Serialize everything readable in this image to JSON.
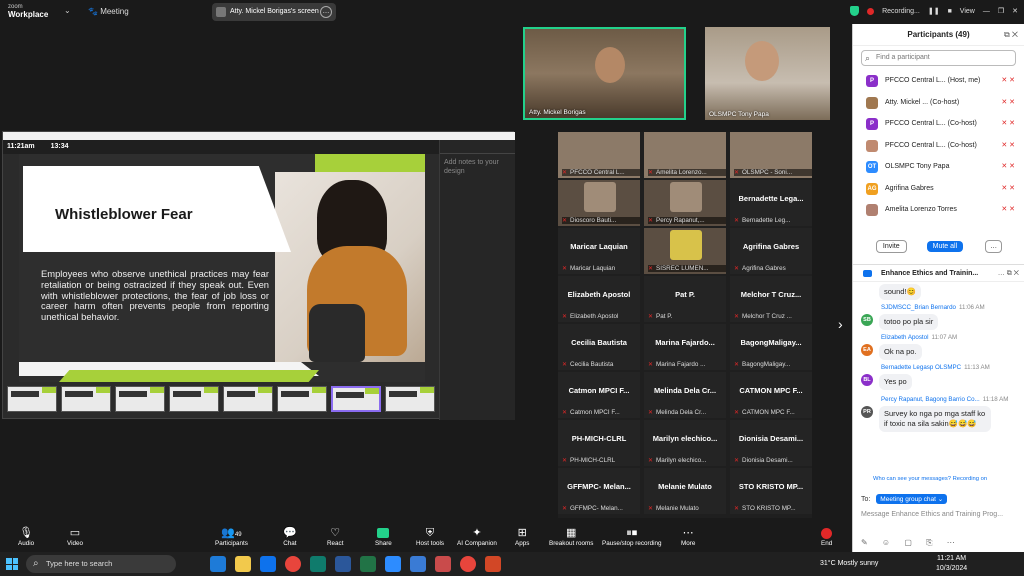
{
  "topbar": {
    "logo_line1": "zoom",
    "logo_line2": "Workplace",
    "meeting_label": "Meeting",
    "share_label": "Atty. Mickel Borigas's screen",
    "recording_label": "Recording...",
    "view_label": "View"
  },
  "slide": {
    "clock": "11:21am",
    "timer": "13:34",
    "title": "Whistleblower Fear",
    "body": "Employees who observe unethical practices may fear retaliation or being ostracized if they speak out. Even with whistleblower protections, the fear of job loss or career harm often prevents people from reporting unethical behavior.",
    "notes_placeholder": "Add notes to your design"
  },
  "speakers": [
    {
      "name": "Atty. Mickel Borigas"
    },
    {
      "name": "OLSMPC Tony Papa"
    }
  ],
  "gallery": [
    {
      "name": "",
      "sub": "PFCCO Central L..."
    },
    {
      "name": "",
      "sub": "Amelita Lorenzo..."
    },
    {
      "name": "",
      "sub": "OLSMPC - Soni..."
    },
    {
      "name": "",
      "sub": "Dioscoro Bauti..."
    },
    {
      "name": "",
      "sub": "Percy Rapanut,..."
    },
    {
      "name": "Bernadette Lega...",
      "sub": "Bernadette Leg..."
    },
    {
      "name": "Maricar Laquian",
      "sub": "Maricar Laquian"
    },
    {
      "name": "",
      "sub": "SISREC LUMEN..."
    },
    {
      "name": "Agrifina Gabres",
      "sub": "Agrifina Gabres"
    },
    {
      "name": "Elizabeth Apostol",
      "sub": "Elizabeth Apostol"
    },
    {
      "name": "Pat P.",
      "sub": "Pat P."
    },
    {
      "name": "Melchor T Cruz...",
      "sub": "Melchor T Cruz ..."
    },
    {
      "name": "Cecilia Bautista",
      "sub": "Cecilia Bautista"
    },
    {
      "name": "Marina  Fajardo...",
      "sub": "Marina Fajardo ..."
    },
    {
      "name": "BagongMaligay...",
      "sub": "BagongMaligay..."
    },
    {
      "name": "Catmon MPCI F...",
      "sub": "Catmon MPCI F..."
    },
    {
      "name": "Melinda Dela Cr...",
      "sub": "Melinda Dela Cr..."
    },
    {
      "name": "CATMON MPC F...",
      "sub": "CATMON MPC F..."
    },
    {
      "name": "PH-MICH-CLRL",
      "sub": "PH-MICH-CLRL"
    },
    {
      "name": "Marilyn elechico...",
      "sub": "Marilyn elechico..."
    },
    {
      "name": "Dionisia Desami...",
      "sub": "Dionisia Desami..."
    },
    {
      "name": "GFFMPC- Melan...",
      "sub": "GFFMPC- Melan..."
    },
    {
      "name": "Melanie Mulato",
      "sub": "Melanie Mulato"
    },
    {
      "name": "STO KRISTO MP...",
      "sub": "STO KRISTO MP..."
    }
  ],
  "participants": {
    "title": "Participants (49)",
    "search_placeholder": "Find a participant",
    "rows": [
      {
        "initials": "P",
        "name": "PFCCO Central L... (Host, me)",
        "color": "#8b2fc9"
      },
      {
        "initials": "",
        "name": "Atty. Mickel ... (Co-host)",
        "color": "#a07850"
      },
      {
        "initials": "P",
        "name": "PFCCO Central L... (Co-host)",
        "color": "#8b2fc9"
      },
      {
        "initials": "",
        "name": "PFCCO Central L... (Co-host)",
        "color": "#c08a70"
      },
      {
        "initials": "OT",
        "name": "OLSMPC Tony Papa",
        "color": "#2d8cff"
      },
      {
        "initials": "AG",
        "name": "Agrifina Gabres",
        "color": "#f0a020"
      },
      {
        "initials": "",
        "name": "Amelita Lorenzo Torres",
        "color": "#b08070"
      }
    ],
    "invite_label": "Invite",
    "mute_all_label": "Mute all"
  },
  "chat": {
    "title": "Enhance Ethics and Trainin...",
    "messages": [
      {
        "sender": "",
        "time": "",
        "text": "sound!😊",
        "initials": "",
        "color": "#ffffff"
      },
      {
        "sender": "SJDMSCC_Brian Bernardo",
        "time": "11:06 AM",
        "text": "totoo po pla sir",
        "initials": "SB",
        "color": "#3aa655"
      },
      {
        "sender": "Elizabeth Apostol",
        "time": "11:07 AM",
        "text": "Ok na po.",
        "initials": "EA",
        "color": "#e07020"
      },
      {
        "sender": "Bernadette Legasp  OLSMPC",
        "time": "11:13 AM",
        "text": "Yes po",
        "initials": "BL",
        "color": "#8b2fc9"
      },
      {
        "sender": "Percy Rapanut, Bagong Barrio Co...",
        "time": "11:18 AM",
        "text": "Survey ko nga po mga staff ko if toxic na sila sakin😅😅😅",
        "initials": "PR",
        "color": "#555555"
      }
    ],
    "who_can_see": "Who can see your messages? Recording on",
    "to_label": "To:",
    "to_target": "Meeting group chat ⌄",
    "input_placeholder": "Message Enhance Ethics and Training Prog..."
  },
  "toolbar": {
    "audio": "Audio",
    "video": "Video",
    "participants": "Participants",
    "participants_count": "49",
    "chat": "Chat",
    "react": "React",
    "share": "Share",
    "host_tools": "Host tools",
    "ai_companion": "AI Companion",
    "apps": "Apps",
    "breakout": "Breakout rooms",
    "pause_stop": "Pause/stop recording",
    "more": "More",
    "end": "End"
  },
  "taskbar": {
    "search_placeholder": "Type here to search",
    "weather": "31°C  Mostly sunny",
    "time": "11:21 AM",
    "date": "10/3/2024"
  }
}
